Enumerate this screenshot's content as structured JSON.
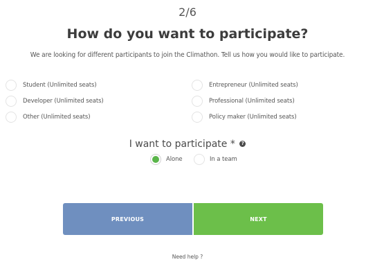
{
  "header": {
    "step": "2/6",
    "title": "How do you want to participate?",
    "subtitle": "We are looking for different participants to join the Climathon. Tell us how you would like to participate."
  },
  "participant_types": {
    "left": [
      {
        "label": "Student (Unlimited seats)",
        "checked": false
      },
      {
        "label": "Developer (Unlimited seats)",
        "checked": false
      },
      {
        "label": "Other (Unlimited seats)",
        "checked": false
      }
    ],
    "right": [
      {
        "label": "Entrepreneur (Unlimited seats)",
        "checked": false
      },
      {
        "label": "Professional (Unlimited seats)",
        "checked": false
      },
      {
        "label": "Policy maker (Unlimited seats)",
        "checked": false
      }
    ]
  },
  "participation_mode": {
    "question": "I want to participate",
    "required_mark": "*",
    "help_icon": "?",
    "options": [
      {
        "label": "Alone",
        "checked": true
      },
      {
        "label": "In a team",
        "checked": false
      }
    ]
  },
  "navigation": {
    "previous_label": "PREVIOUS",
    "next_label": "NEXT",
    "help_label": "Need help ?"
  },
  "colors": {
    "previous_button": "#6f8fbf",
    "next_button": "#6cbf4a",
    "radio_checked": "#5ab54a"
  }
}
